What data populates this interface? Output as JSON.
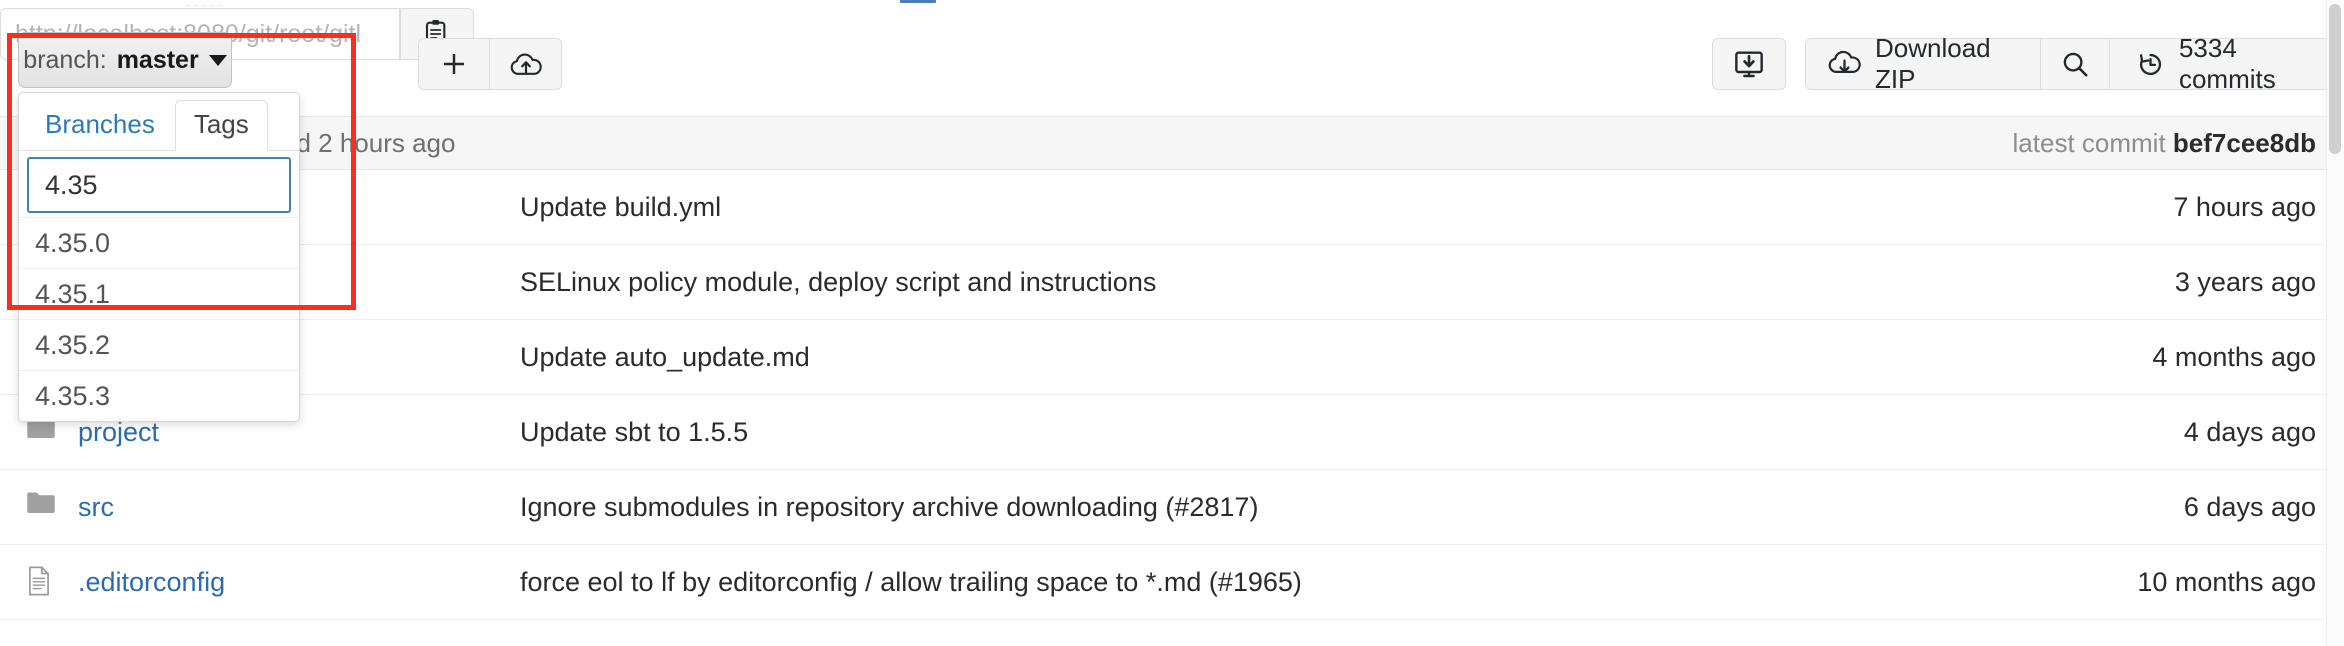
{
  "toolbar": {
    "create_file_label": "+",
    "create_file_icon": "plus-icon",
    "upload_icon": "cloud-upload-icon",
    "clone_url_placeholder": "http://localhost:8080/git/root/gitl",
    "clone_url_value": "",
    "copy_icon": "clipboard-copy-icon",
    "checkout_icon": "download-to-desktop-icon",
    "download_zip_label": "Download ZIP",
    "download_zip_icon": "cloud-download-icon",
    "search_icon": "search-icon",
    "commits_label": "5334 commits",
    "commits_icon": "history-icon"
  },
  "commit_strip": {
    "author_text": "ed 2 hours ago",
    "latest_commit_label": "latest commit",
    "latest_commit_sha": "bef7cee8db"
  },
  "branch_widget": {
    "button_prefix": "branch:",
    "button_value": "master",
    "caret_icon": "chevron-down-icon",
    "tabs": [
      {
        "label": "Branches",
        "active": false
      },
      {
        "label": "Tags",
        "active": true
      }
    ],
    "filter_value": "4.35",
    "filter_placeholder": "",
    "options": [
      {
        "label": "4.35.0"
      },
      {
        "label": "4.35.1"
      },
      {
        "label": "4.35.2"
      },
      {
        "label": "4.35.3"
      }
    ]
  },
  "files": [
    {
      "icon": "folder-icon",
      "name": "",
      "message": "Update build.yml",
      "age": "7 hours ago"
    },
    {
      "icon": "folder-icon",
      "name": "",
      "message": "SELinux policy module, deploy script and instructions",
      "age": "3 years ago"
    },
    {
      "icon": "folder-icon",
      "name": "",
      "message": "Update auto_update.md",
      "age": "4 months ago"
    },
    {
      "icon": "folder-icon",
      "name": "project",
      "message": "Update sbt to 1.5.5",
      "age": "4 days ago"
    },
    {
      "icon": "folder-icon",
      "name": "src",
      "message": "Ignore submodules in repository archive downloading (#2817)",
      "age": "6 days ago"
    },
    {
      "icon": "file-icon",
      "name": ".editorconfig",
      "message": "force eol to lf by editorconfig / allow trailing space to *.md (#1965)",
      "age": "10 months ago"
    }
  ],
  "annotation": {
    "shape": "rectangle",
    "color": "#fa2d1e"
  },
  "colors": {
    "link": "#2b6cb0",
    "tab_link": "#2b7bb9",
    "annotation": "#fa2d1e",
    "toolbar_button_bg": "#f5f5f5",
    "strip_bg": "#f6f6f6"
  }
}
